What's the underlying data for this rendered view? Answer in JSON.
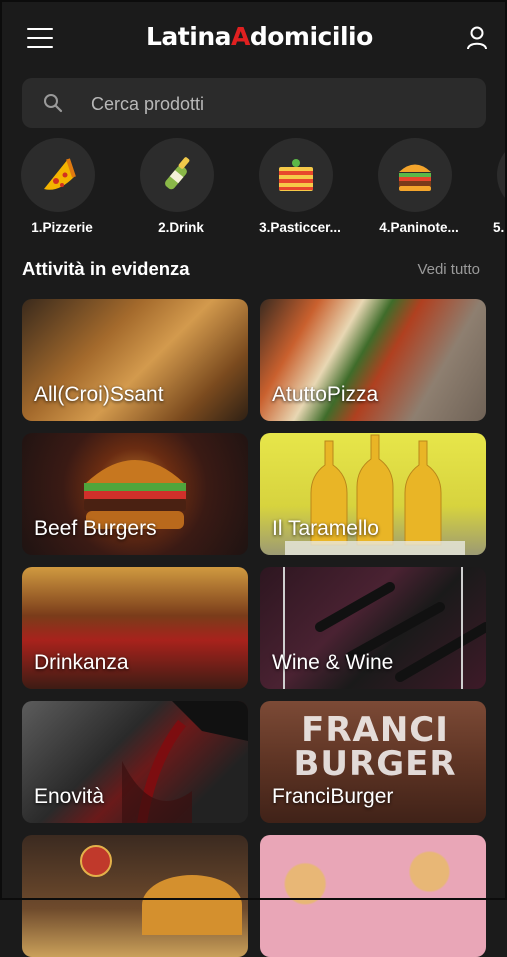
{
  "header": {
    "logo_part1": "Latina",
    "logo_accent": "A",
    "logo_part2": "domicilio",
    "accent_color": "#e02020"
  },
  "search": {
    "placeholder": "Cerca prodotti",
    "icon": "search-icon"
  },
  "categories": [
    {
      "label": "1.Pizzerie",
      "icon": "pizza-slice-icon"
    },
    {
      "label": "2.Drink",
      "icon": "champagne-bottle-icon"
    },
    {
      "label": "3.Pasticcer...",
      "icon": "cake-icon"
    },
    {
      "label": "4.Paninote...",
      "icon": "burger-icon"
    },
    {
      "label": "5.",
      "icon": "category-icon"
    }
  ],
  "featured": {
    "title": "Attività in evidenza",
    "see_all": "Vedi tutto",
    "stores": [
      {
        "name": "All(Croi)Ssant"
      },
      {
        "name": "AtuttoPizza"
      },
      {
        "name": "Beef Burgers"
      },
      {
        "name": "Il Taramello"
      },
      {
        "name": "Drinkanza"
      },
      {
        "name": "Wine & Wine"
      },
      {
        "name": "Enovità"
      },
      {
        "name": "FranciBurger"
      },
      {
        "name": ""
      },
      {
        "name": ""
      }
    ],
    "franci_image_text": "FRANCI BURGER"
  }
}
